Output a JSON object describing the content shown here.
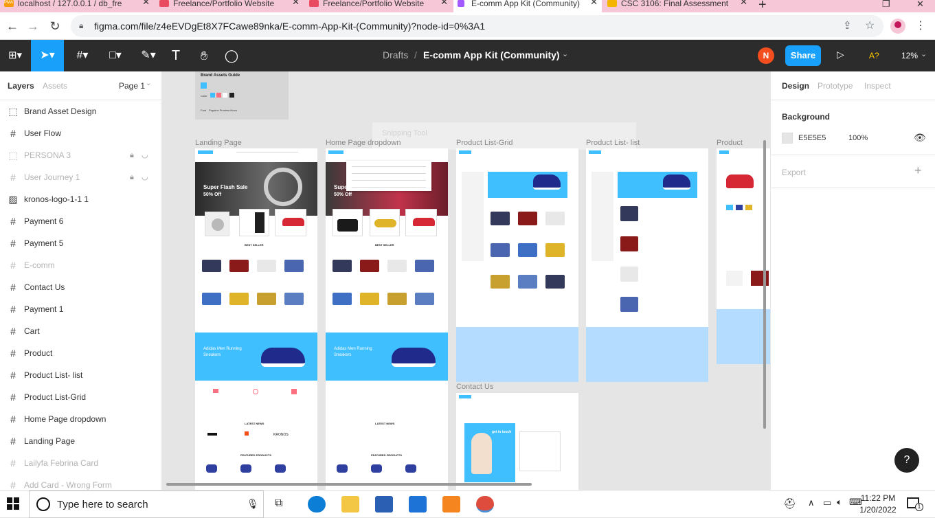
{
  "browser": {
    "tabs": [
      {
        "title": "localhost / 127.0.0.1 / db_fre",
        "favicon_text": "PMA",
        "favicon_color": "#f89c0e"
      },
      {
        "title": "Freelance/Portfolio Website",
        "favicon_color": "#e84a5f"
      },
      {
        "title": "Freelance/Portfolio Website",
        "favicon_color": "#e84a5f"
      },
      {
        "title": "E-comm App Kit (Community)",
        "favicon_color": "#a259ff"
      },
      {
        "title": "CSC 3106: Final Assessment",
        "favicon_color": "#f4b400"
      }
    ],
    "new_tab_glyph": "+",
    "url": "figma.com/file/z4eEVDgEt8X7FCawe89nka/E-comm-App-Kit-(Community)?node-id=0%3A1"
  },
  "figma": {
    "breadcrumb_root": "Drafts",
    "separator": "/",
    "file_name": "E-comm App Kit (Community)",
    "avatar_initial": "N",
    "share_label": "Share",
    "help_label": "A?",
    "zoom": "12%",
    "tool_icons": [
      "figma-menu-icon",
      "move-tool-icon",
      "frame-tool-icon",
      "shape-tool-icon",
      "pen-tool-icon",
      "text-tool-icon",
      "hand-tool-icon",
      "comment-tool-icon"
    ]
  },
  "layers_panel": {
    "tab_layers": "Layers",
    "tab_assets": "Assets",
    "page_label": "Page 1",
    "items": [
      {
        "label": "Brand Asset Design",
        "icon": "section-icon",
        "dim": false,
        "locked": false
      },
      {
        "label": "User Flow",
        "icon": "frame-icon",
        "dim": false,
        "locked": false
      },
      {
        "label": "PERSONA 3",
        "icon": "section-icon",
        "dim": true,
        "locked": true
      },
      {
        "label": "User Journey 1",
        "icon": "frame-icon",
        "dim": true,
        "locked": true
      },
      {
        "label": "kronos-logo-1-1 1",
        "icon": "image-icon",
        "dim": false,
        "locked": false
      },
      {
        "label": "Payment 6",
        "icon": "frame-icon",
        "dim": false,
        "locked": false
      },
      {
        "label": "Payment 5",
        "icon": "frame-icon",
        "dim": false,
        "locked": false
      },
      {
        "label": "E-comm",
        "icon": "frame-icon",
        "dim": true,
        "locked": false
      },
      {
        "label": "Contact Us",
        "icon": "frame-icon",
        "dim": false,
        "locked": false
      },
      {
        "label": "Payment 1",
        "icon": "frame-icon",
        "dim": false,
        "locked": false
      },
      {
        "label": "Cart",
        "icon": "frame-icon",
        "dim": false,
        "locked": false
      },
      {
        "label": "Product",
        "icon": "frame-icon",
        "dim": false,
        "locked": false
      },
      {
        "label": "Product List- list",
        "icon": "frame-icon",
        "dim": false,
        "locked": false
      },
      {
        "label": "Product List-Grid",
        "icon": "frame-icon",
        "dim": false,
        "locked": false
      },
      {
        "label": "Home Page dropdown",
        "icon": "frame-icon",
        "dim": false,
        "locked": false
      },
      {
        "label": "Landing Page",
        "icon": "frame-icon",
        "dim": false,
        "locked": false
      },
      {
        "label": "Lailyfa Febrina Card",
        "icon": "frame-icon",
        "dim": true,
        "locked": false
      },
      {
        "label": "Add Card - Wrong Form",
        "icon": "frame-icon",
        "dim": true,
        "locked": false
      }
    ]
  },
  "canvas": {
    "brand_title": "Brand Assets Guide",
    "brand_color_label": "Color",
    "brand_font_label": "Font",
    "brand_font_names": "Poppins   Proxima Nova",
    "frame_labels": [
      "Landing Page",
      "Home Page dropdown",
      "Product List-Grid",
      "Product List- list",
      "Product",
      "Contact Us"
    ],
    "hero_title": "Super Flash Sale",
    "hero_sub": "50% Off",
    "banner_title": "Adidas Men Running Sneakers",
    "best_seller": "BEST SELLER",
    "latest_news": "LATEST NEWS",
    "featured": "FEATURED PRODUCTS",
    "snipping_ghost": "Snipping Tool",
    "contact_hero": "get in touch"
  },
  "design_panel": {
    "tab_design": "Design",
    "tab_prototype": "Prototype",
    "tab_inspect": "Inspect",
    "background_label": "Background",
    "background_hex": "E5E5E5",
    "background_opacity": "100%",
    "export_label": "Export",
    "add_glyph": "+",
    "help_glyph": "?"
  },
  "taskbar": {
    "search_placeholder": "Type here to search",
    "time": "11:22 PM",
    "date": "1/20/2022",
    "notification_count": "1"
  },
  "colors": {
    "figma_dark": "#2c2c2c",
    "figma_blue": "#18a0fb",
    "accent_blue": "#40bfff",
    "avatar": "#f24e1e",
    "help_yellow": "#ffc700",
    "sale_red": "#fb7181"
  }
}
